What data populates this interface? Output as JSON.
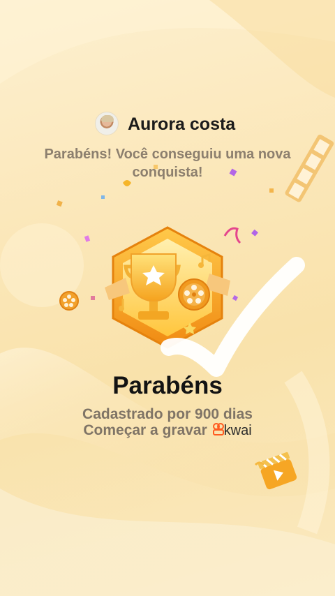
{
  "user": {
    "name": "Aurora costa"
  },
  "message": {
    "line1": "Parabéns! Você conseguiu uma nova",
    "line2": "conquista!"
  },
  "achievement": {
    "title": "Parabéns",
    "subtitle": "Cadastrado por 900 dias",
    "record_label": "Começar a gravar",
    "brand": "kwai"
  },
  "colors": {
    "background": "#fbe7b9",
    "badge_outer": "#f6a21a",
    "badge_inner": "#ffcf4a",
    "text_dark": "#131313",
    "text_muted": "#7f7466"
  },
  "icons": [
    "avatar",
    "trophy-badge-icon",
    "film-reel-icon",
    "film-strip-icon",
    "clapperboard-icon",
    "checkmark-stroke",
    "kwai-logo-icon"
  ]
}
